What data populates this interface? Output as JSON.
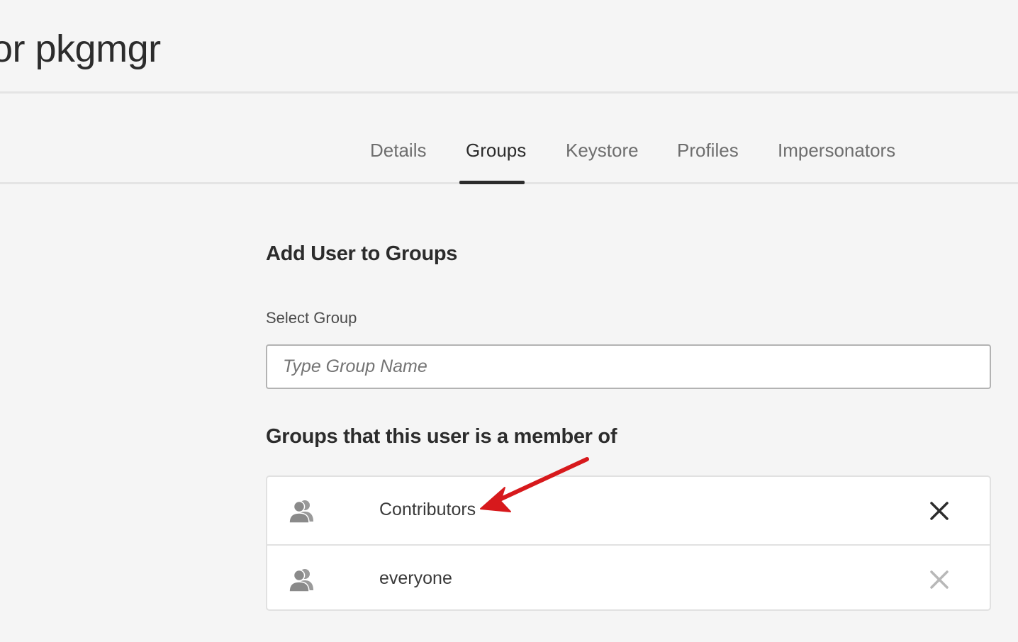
{
  "header": {
    "title": "or pkgmgr"
  },
  "tabs": [
    {
      "label": "Details",
      "active": false
    },
    {
      "label": "Groups",
      "active": true
    },
    {
      "label": "Keystore",
      "active": false
    },
    {
      "label": "Profiles",
      "active": false
    },
    {
      "label": "Impersonators",
      "active": false
    }
  ],
  "add_section": {
    "heading": "Add User to Groups",
    "field_label": "Select Group",
    "input_value": "",
    "input_placeholder": "Type Group Name"
  },
  "membership_section": {
    "heading": "Groups that this user is a member of",
    "groups": [
      {
        "name": "Contributors",
        "icon": "user-group-icon",
        "remove_icon": "close-icon",
        "removable": true
      },
      {
        "name": "everyone",
        "icon": "user-group-icon",
        "remove_icon": "close-icon",
        "removable": false
      }
    ]
  },
  "colors": {
    "background": "#f5f5f5",
    "text": "#2c2c2c",
    "tab_inactive": "#6e6e6e",
    "annotation_arrow": "#d7191c",
    "remove_enabled": "#2c2c2c",
    "remove_disabled": "#b8b8b8"
  }
}
